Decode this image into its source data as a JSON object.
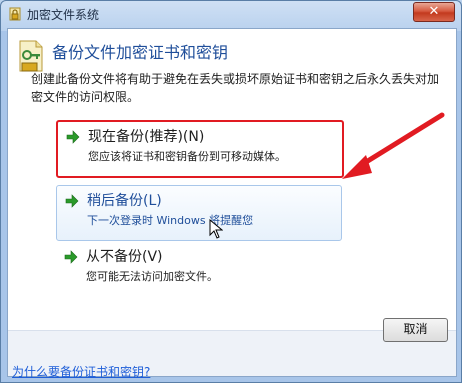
{
  "window": {
    "title": "加密文件系统",
    "close_label": "✕"
  },
  "header": {
    "title": "备份文件加密证书和密钥"
  },
  "description": "创建此备份文件将有助于避免在丢失或损坏原始证书和密钥之后永久丢失对加密文件的访问权限。",
  "options": [
    {
      "label": "现在备份(推荐)(N)",
      "sub": "您应该将证书和密钥备份到可移动媒体。",
      "label_color": "#1e1e1e",
      "sub_color": "#1e1e1e"
    },
    {
      "label": "稍后备份(L)",
      "sub": "下一次登录时 Windows 将提醒您",
      "label_color": "#1f4e9a",
      "sub_color": "#1f4e9a"
    },
    {
      "label": "从不备份(V)",
      "sub": "您可能无法访问加密文件。",
      "label_color": "#1e1e1e",
      "sub_color": "#1e1e1e"
    }
  ],
  "footer": {
    "cancel_label": "取消",
    "help_link": "为什么要备份证书和密钥?"
  },
  "colors": {
    "accent_arrow": "#2a9a2a",
    "highlight": "#e11b22",
    "link": "#1e5ed8"
  }
}
